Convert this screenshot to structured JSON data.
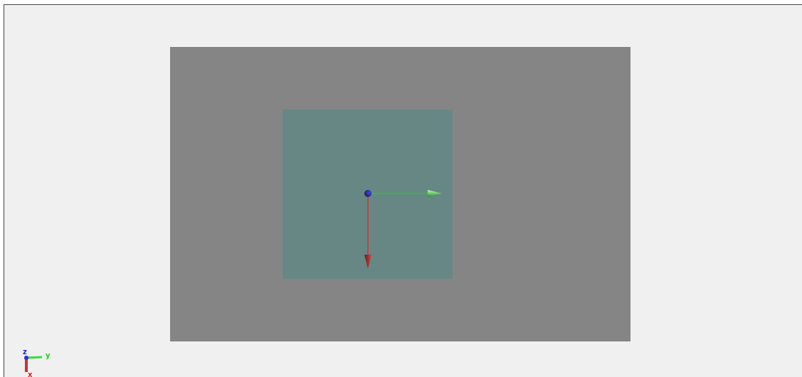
{
  "viewport": {
    "triad": [
      {
        "text": "z",
        "color": "#2020e0"
      },
      {
        "text": "y",
        "color": "#20d020"
      },
      {
        "text": "x",
        "color": "#e02020"
      }
    ]
  }
}
